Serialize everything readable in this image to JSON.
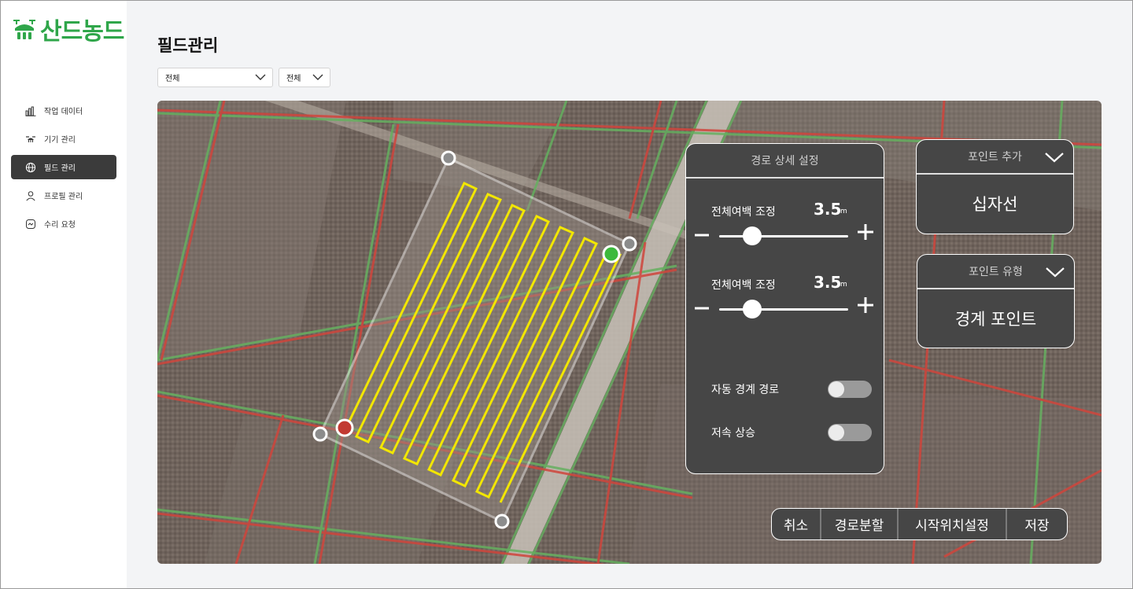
{
  "app": {
    "logo_text": "산드농드",
    "brand_color": "#2fa64a"
  },
  "sidebar": {
    "items": [
      {
        "label": "작업 데이터",
        "icon": "bar-chart-icon",
        "active": false
      },
      {
        "label": "기기 관리",
        "icon": "drone-icon",
        "active": false
      },
      {
        "label": "필드 관리",
        "icon": "globe-icon",
        "active": true
      },
      {
        "label": "프로필 관리",
        "icon": "user-icon",
        "active": false
      },
      {
        "label": "수리 요청",
        "icon": "repair-icon",
        "active": false
      }
    ]
  },
  "header": {
    "title": "필드관리",
    "filter1": "전체",
    "filter2": "전체"
  },
  "route_panel": {
    "title": "경로 상세 설정",
    "slider1": {
      "label": "전체여백 조정",
      "value": "3.5",
      "unit": "m"
    },
    "slider2": {
      "label": "전체여백 조정",
      "value": "3.5",
      "unit": "m"
    },
    "toggle1": {
      "label": "자동 경계 경로",
      "on": false
    },
    "toggle2": {
      "label": "저속 상승",
      "on": false
    }
  },
  "point_add": {
    "label": "포인트 추가",
    "value": "십자선"
  },
  "point_type": {
    "label": "포인트 유형",
    "value": "경계 포인트"
  },
  "actions": {
    "cancel": "취소",
    "split_route": "경로분할",
    "set_start": "시작위치설정",
    "save": "저장"
  },
  "colors": {
    "panel_bg": "#464646",
    "route_line": "#f2e600",
    "start_point": "#3cb93c",
    "end_point": "#c23a33",
    "active_nav": "#3b3b3b"
  }
}
